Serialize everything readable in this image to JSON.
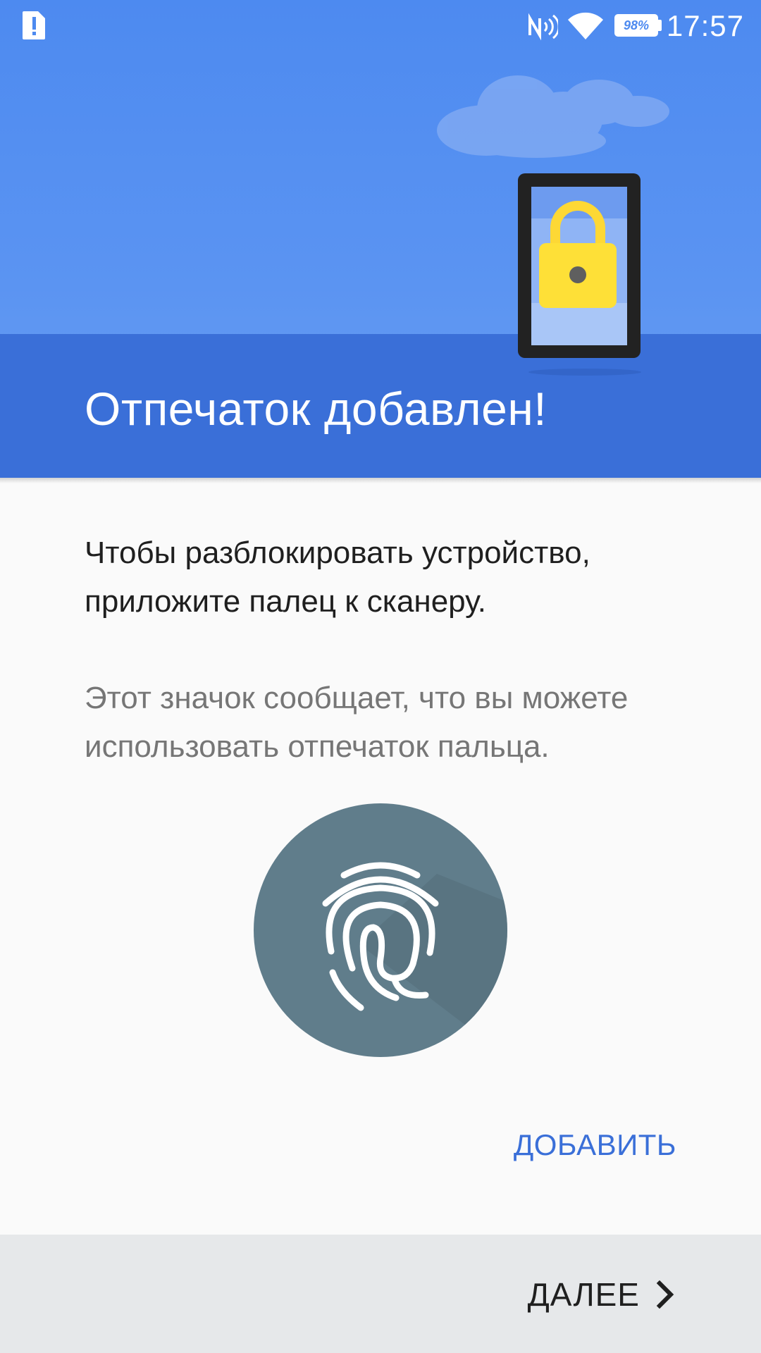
{
  "status_bar": {
    "time": "17:57",
    "battery_percent": "98%",
    "icons": [
      "alert-icon",
      "nfc-icon",
      "wifi-icon",
      "battery-icon"
    ]
  },
  "header": {
    "title": "Отпечаток добавлен!"
  },
  "content": {
    "instruction": "Чтобы разблокировать устройство, приложите палец к сканеру.",
    "hint": "Этот значок сообщает, что вы можете использовать отпечаток пальца."
  },
  "actions": {
    "add_label": "ДОБАВИТЬ",
    "next_label": "ДАЛЕЕ"
  },
  "colors": {
    "header_blue": "#4d8af0",
    "band_blue": "#3a6fd8",
    "accent": "#3a6fd8",
    "fingerprint_circle": "#607d8b",
    "lock_yellow": "#ffeb3b"
  }
}
